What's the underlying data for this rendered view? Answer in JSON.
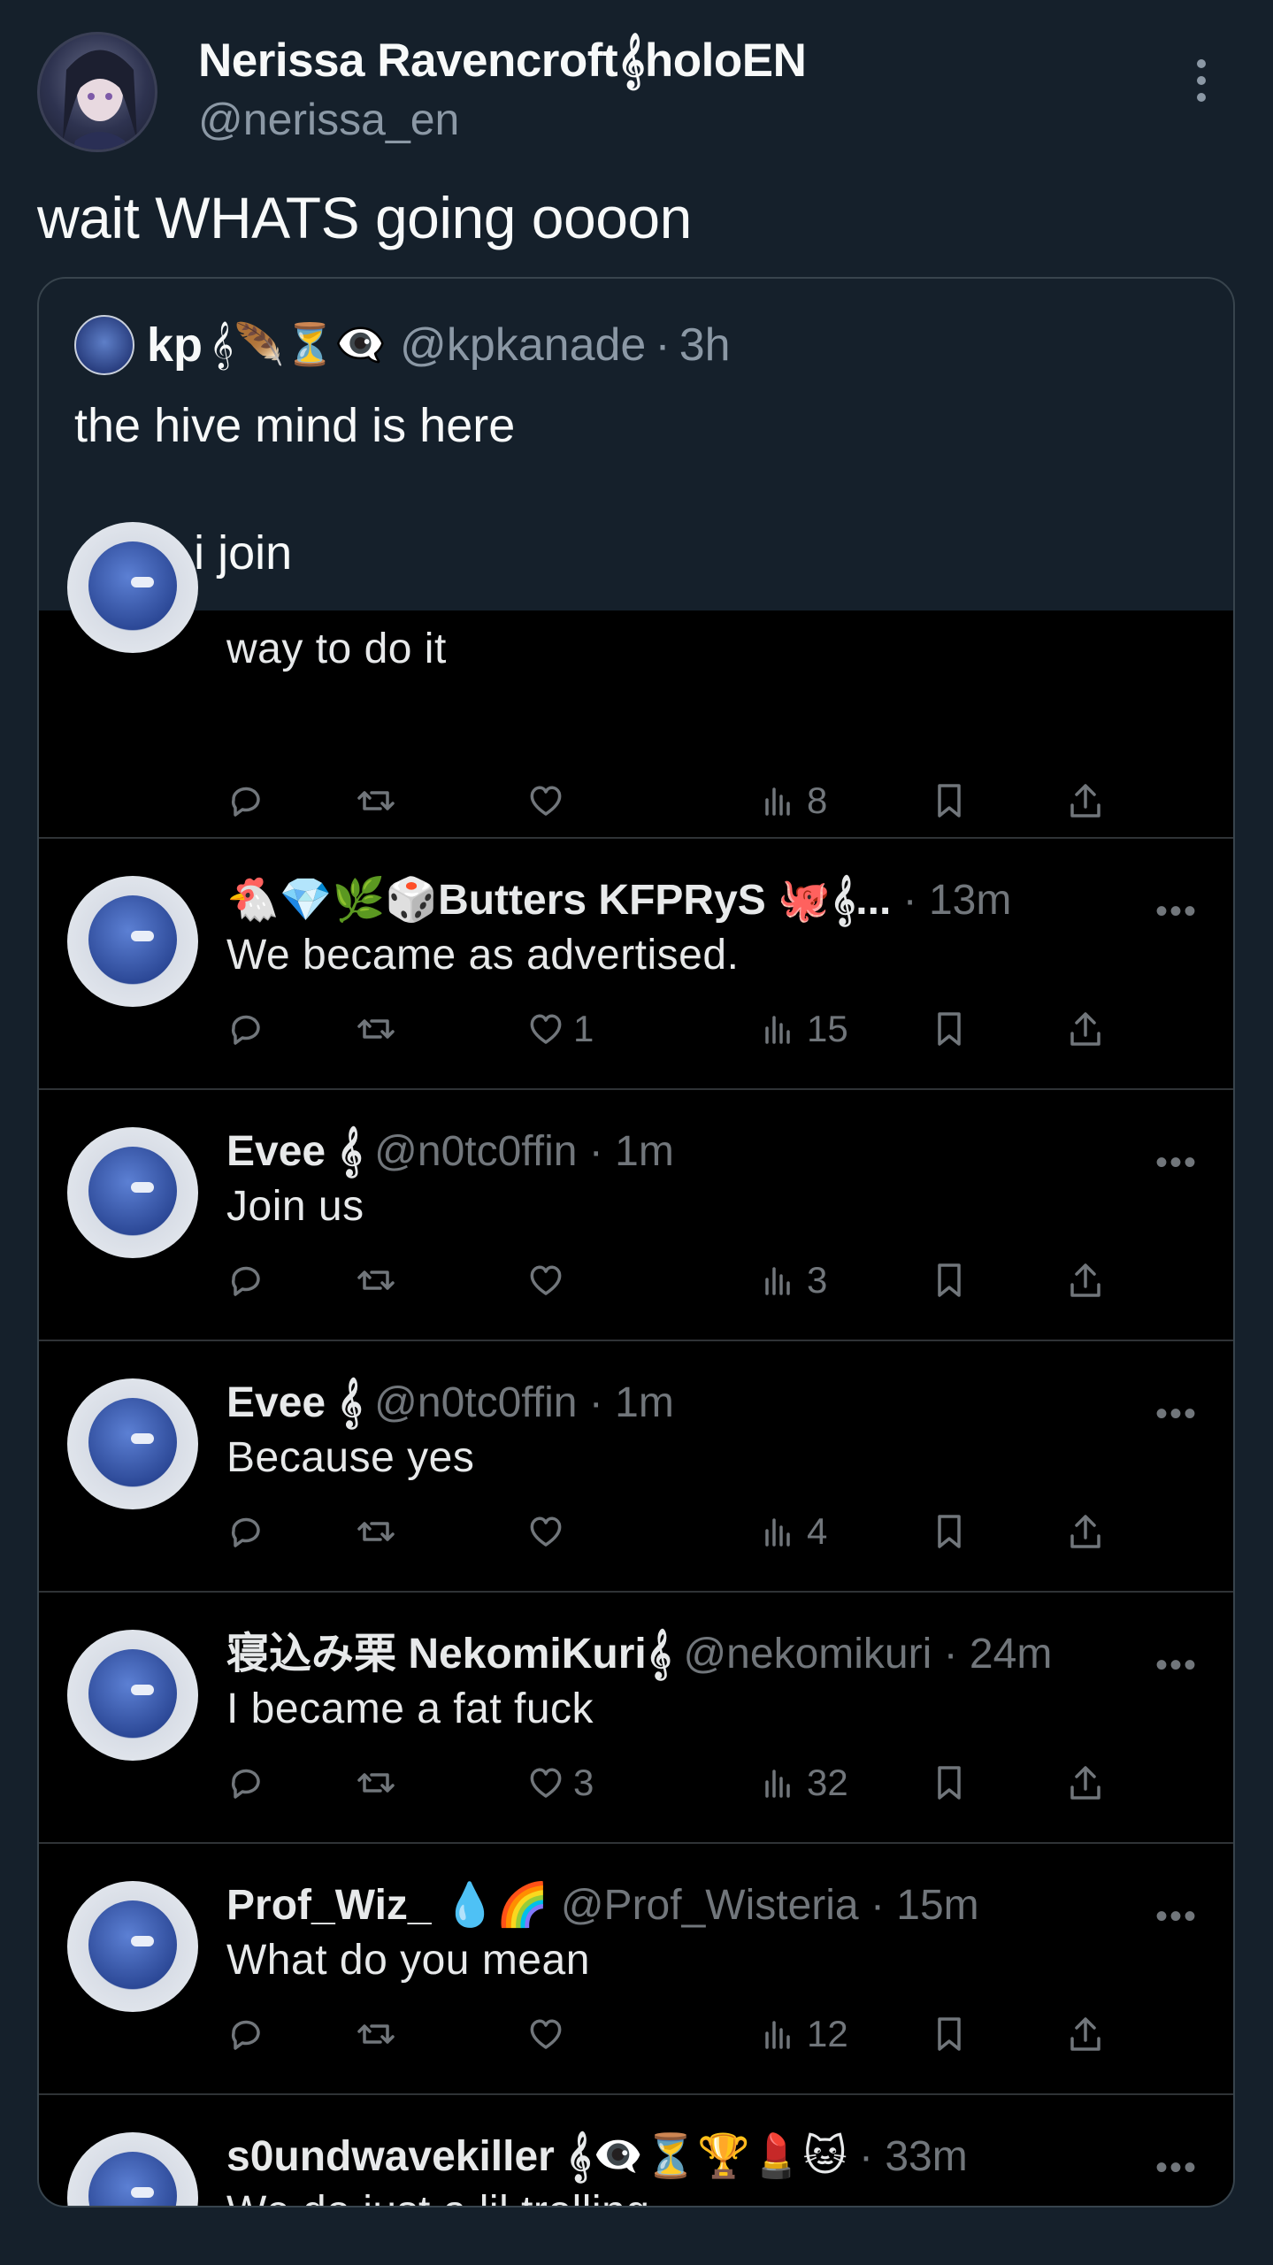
{
  "post": {
    "author_name": "Nerissa Ravencroft𝄞holoEN",
    "author_handle": "@nerissa_en",
    "text": "wait WHATS going oooon"
  },
  "quote": {
    "name": "kp",
    "emojis": "𝄞🪶⏳👁‍🗨",
    "handle": "@kpkanade",
    "time": "3h",
    "text": "the hive mind is here\n\n... do i join"
  },
  "replies": [
    {
      "name": "",
      "handle": "",
      "time": "",
      "text": "way to do it",
      "likes": "",
      "views": "8"
    },
    {
      "name": "🐔💎🌿🎲Butters KFPRyS 🐙𝄞...",
      "handle": "",
      "time": "13m",
      "text": "We became as advertised.",
      "likes": "1",
      "views": "15"
    },
    {
      "name": "Evee 𝄞",
      "handle": "@n0tc0ffin",
      "time": "1m",
      "text": "Join us",
      "likes": "",
      "views": "3"
    },
    {
      "name": "Evee 𝄞",
      "handle": "@n0tc0ffin",
      "time": "1m",
      "text": "Because yes",
      "likes": "",
      "views": "4"
    },
    {
      "name": "寝込み栗 NekomiKuri𝄞",
      "handle": "@nekomikuri",
      "time": "24m",
      "text": "I became a fat fuck",
      "likes": "3",
      "views": "32"
    },
    {
      "name": "Prof_Wiz_ 💧🌈",
      "handle": "@Prof_Wisteria",
      "time": "15m",
      "text": "What do you mean",
      "likes": "",
      "views": "12"
    },
    {
      "name": "s0undwavekiller 𝄞👁‍🗨⏳🏆💄🐱",
      "handle": "",
      "time": "33m",
      "text": "We do just a lil trolling",
      "likes": "",
      "views": ""
    }
  ],
  "icons": [
    "reply-icon",
    "retweet-icon",
    "like-icon",
    "views-icon",
    "bookmark-icon",
    "share-icon",
    "more-icon"
  ],
  "colors": {
    "background": "#15202b",
    "secondary_text": "#8b98a5",
    "reply_background": "#000000"
  }
}
